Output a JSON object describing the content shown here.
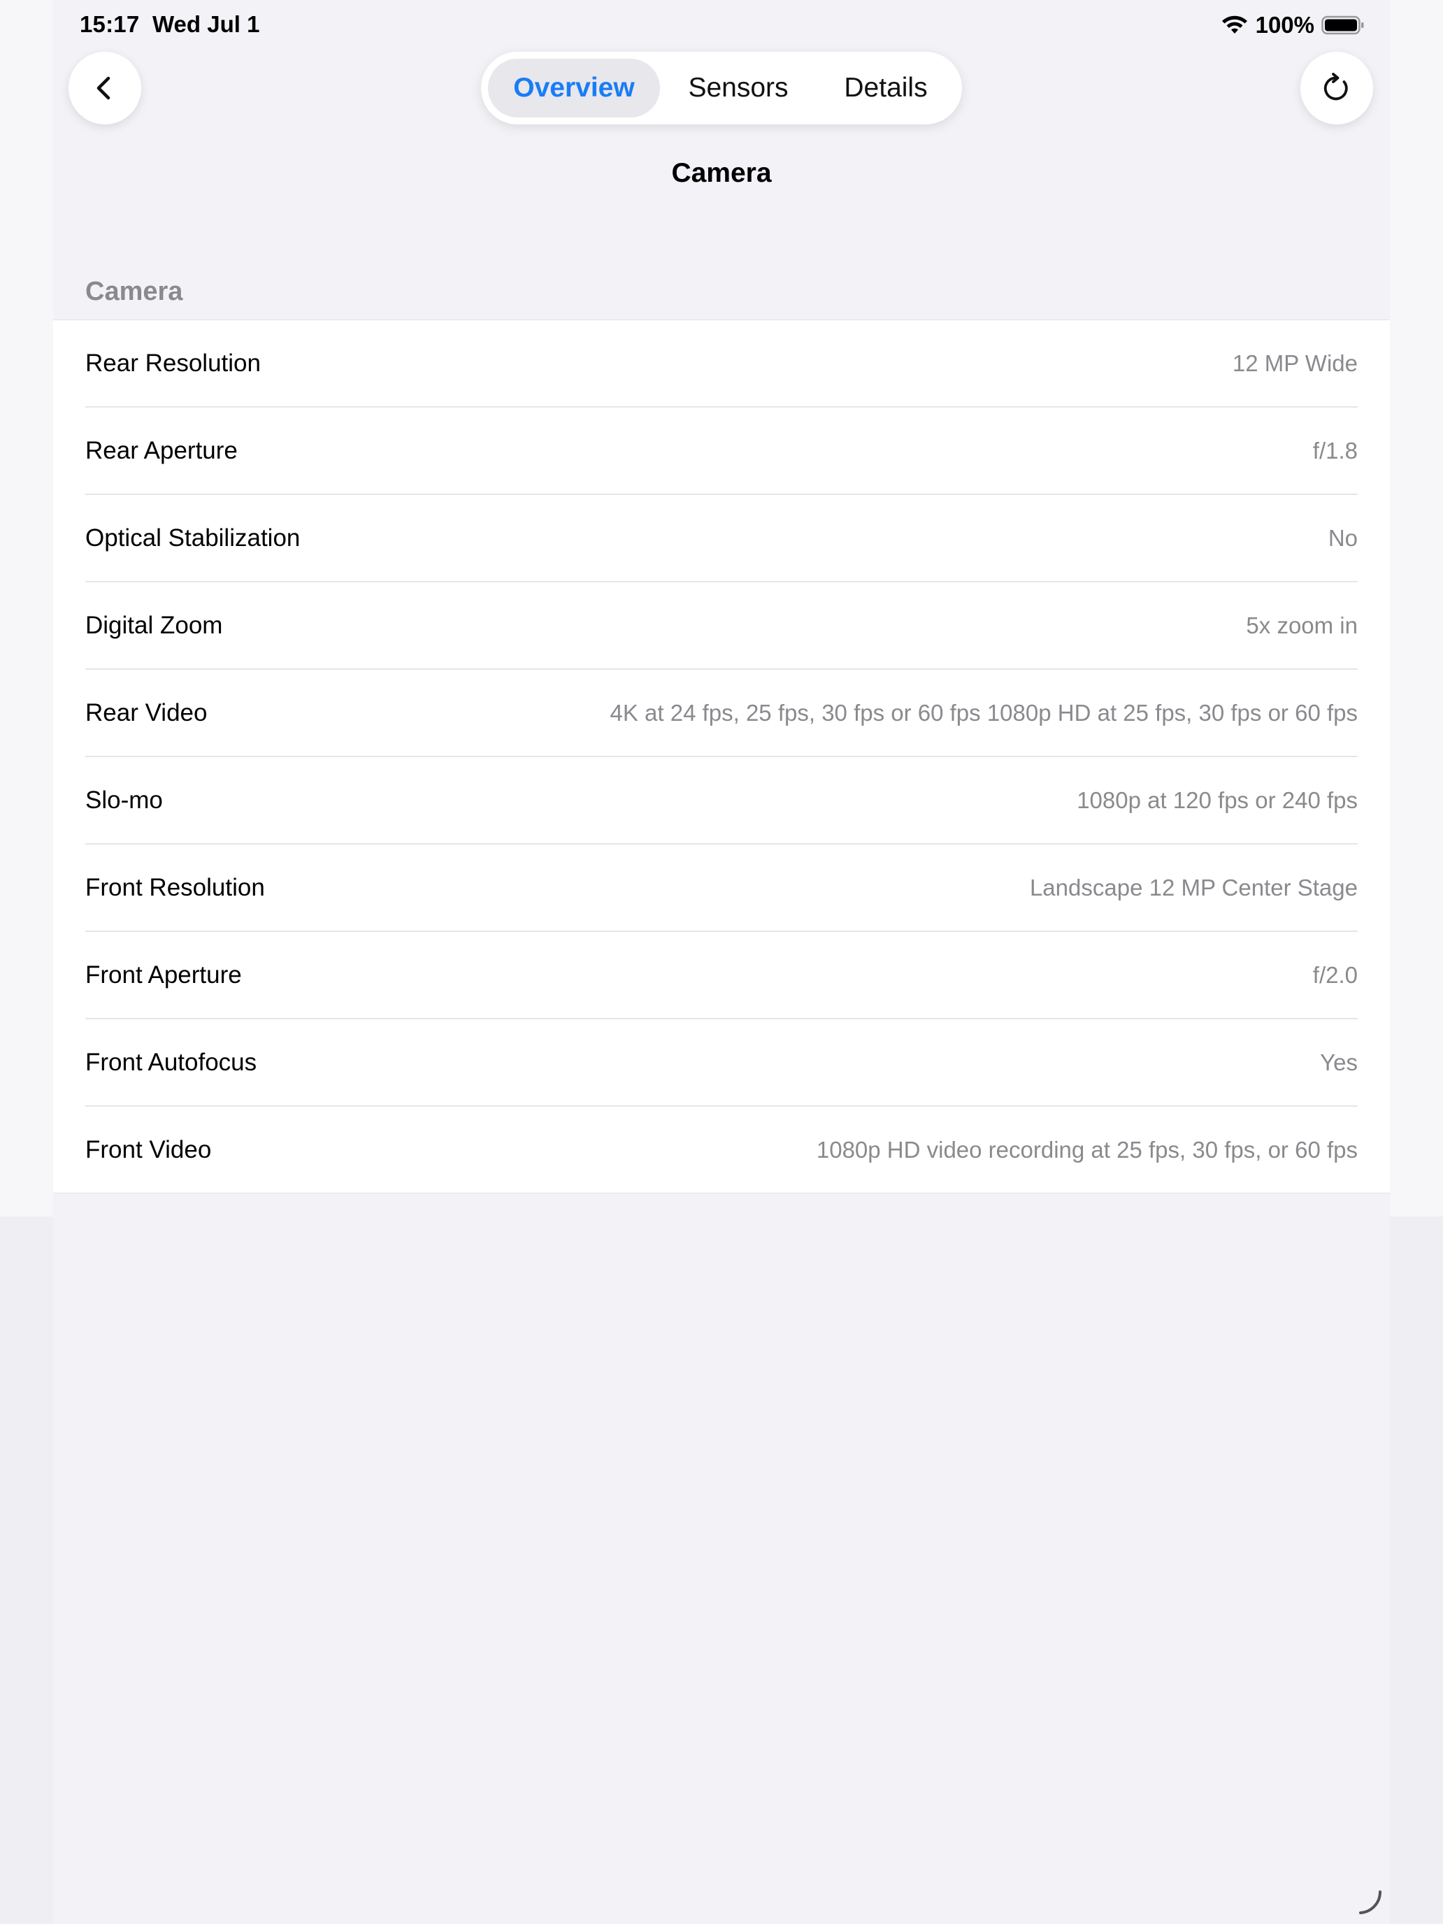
{
  "status_bar": {
    "time": "15:17",
    "date": "Wed Jul 1",
    "battery": "100%"
  },
  "nav": {
    "tabs": [
      {
        "label": "Overview",
        "active": true
      },
      {
        "label": "Sensors",
        "active": false
      },
      {
        "label": "Details",
        "active": false
      }
    ],
    "title": "Camera",
    "back_icon": "chevron-left-icon",
    "refresh_icon": "refresh-icon"
  },
  "section": {
    "header": "Camera",
    "rows": [
      {
        "label": "Rear Resolution",
        "value": "12 MP Wide"
      },
      {
        "label": "Rear Aperture",
        "value": "f/1.8"
      },
      {
        "label": "Optical Stabilization",
        "value": "No"
      },
      {
        "label": "Digital Zoom",
        "value": "5x zoom in"
      },
      {
        "label": "Rear Video",
        "value": "4K at 24 fps, 25 fps, 30 fps or 60 fps 1080p HD at 25 fps, 30 fps or 60 fps"
      },
      {
        "label": "Slo-mo",
        "value": "1080p at 120 fps or 240 fps"
      },
      {
        "label": "Front Resolution",
        "value": "Landscape 12 MP Center Stage"
      },
      {
        "label": "Front Aperture",
        "value": "f/2.0"
      },
      {
        "label": "Front Autofocus",
        "value": "Yes"
      },
      {
        "label": "Front Video",
        "value": "1080p HD video recording at 25 fps, 30 fps, or 60 fps"
      }
    ]
  },
  "colors": {
    "accent": "#1a7cf5",
    "background": "#f2f2f7",
    "secondary_text": "#8a8a8e"
  }
}
